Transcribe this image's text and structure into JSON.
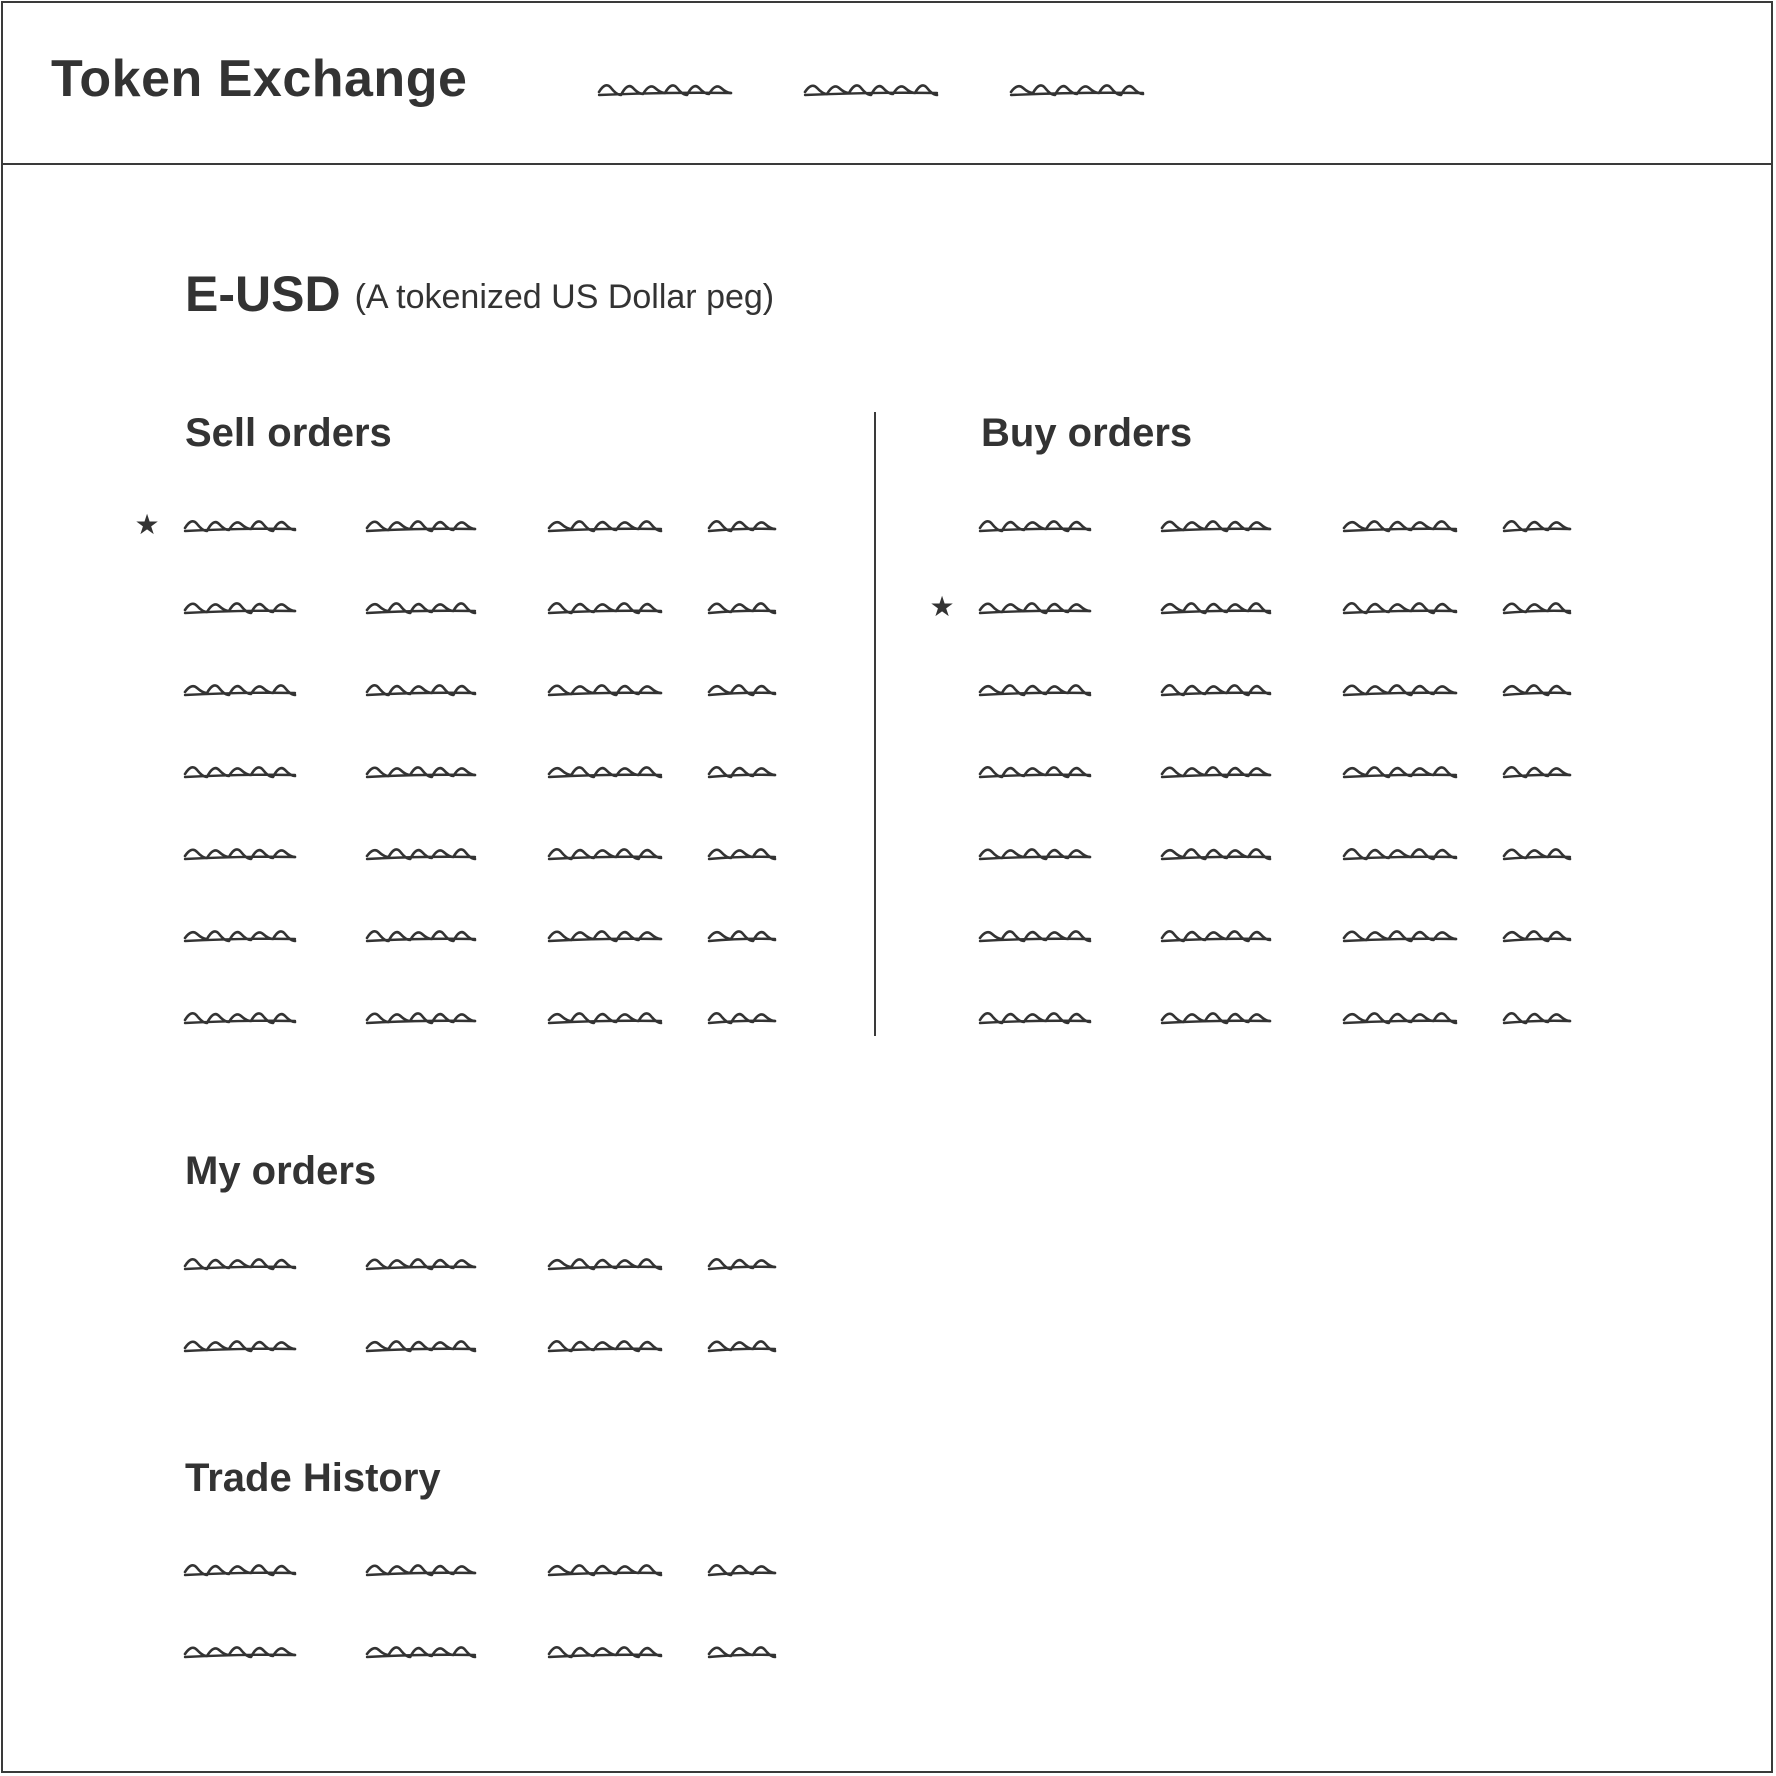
{
  "header": {
    "app_title": "Token Exchange",
    "nav_items": [
      {
        "label": "",
        "icon": "scribble-placeholder"
      },
      {
        "label": "",
        "icon": "scribble-placeholder"
      },
      {
        "label": "",
        "icon": "scribble-placeholder"
      }
    ]
  },
  "token": {
    "name": "E-USD",
    "description": "(A tokenized US Dollar peg)"
  },
  "sections": {
    "sell_orders": {
      "title": "Sell orders",
      "row_count": 7,
      "starred_row": 0
    },
    "buy_orders": {
      "title": "Buy orders",
      "row_count": 7,
      "starred_row": 1
    },
    "my_orders": {
      "title": "My orders",
      "row_count": 2
    },
    "trade_history": {
      "title": "Trade History",
      "row_count": 2
    }
  },
  "icons": {
    "star": "★",
    "placeholder_text": "scribble-placeholder"
  },
  "colors": {
    "ink": "#333333",
    "border": "#3a3a3a",
    "background": "#ffffff"
  }
}
